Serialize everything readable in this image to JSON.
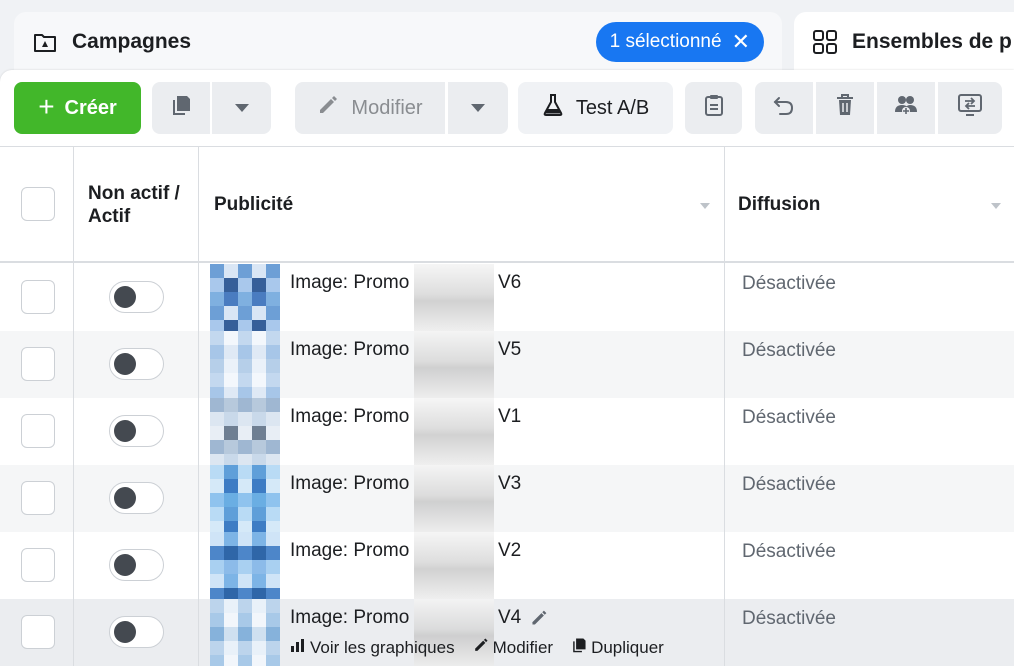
{
  "tabs": {
    "campaigns": {
      "label": "Campagnes",
      "selected_label": "1 sélectionné",
      "close_glyph": "✕"
    },
    "adsets": {
      "label": "Ensembles de p"
    }
  },
  "toolbar": {
    "create_label": "Créer",
    "create_glyph": "+",
    "edit_label": "Modifier",
    "abtest_label": "Test A/B"
  },
  "table": {
    "headers": {
      "toggle": "Non actif / Actif",
      "ad": "Publicité",
      "delivery": "Diffusion"
    },
    "rows": [
      {
        "name": "Image: Promo",
        "version": "V6",
        "delivery": "Désactivée"
      },
      {
        "name": "Image: Promo",
        "version": "V5",
        "delivery": "Désactivée"
      },
      {
        "name": "Image: Promo",
        "version": "V1",
        "delivery": "Désactivée"
      },
      {
        "name": "Image: Promo",
        "version": "V3",
        "delivery": "Désactivée"
      },
      {
        "name": "Image: Promo",
        "version": "V2",
        "delivery": "Désactivée"
      },
      {
        "name": "Image: Promo",
        "version": "V4",
        "delivery": "Désactivée"
      }
    ],
    "row_actions": {
      "charts": "Voir les graphiques",
      "edit": "Modifier",
      "duplicate": "Dupliquer"
    }
  },
  "colors": {
    "accent_blue": "#1877f2",
    "create_green": "#42b72a"
  },
  "icons": {
    "campaign_tab": "folder-flag-icon",
    "adsets_tab": "grid-icon",
    "duplicate": "duplicate-icon",
    "edit": "pencil-icon",
    "abtest": "flask-icon",
    "clipboard": "clipboard-icon",
    "undo": "undo-icon",
    "delete": "trash-icon",
    "audience": "audience-icon",
    "compare": "compare-icon"
  }
}
